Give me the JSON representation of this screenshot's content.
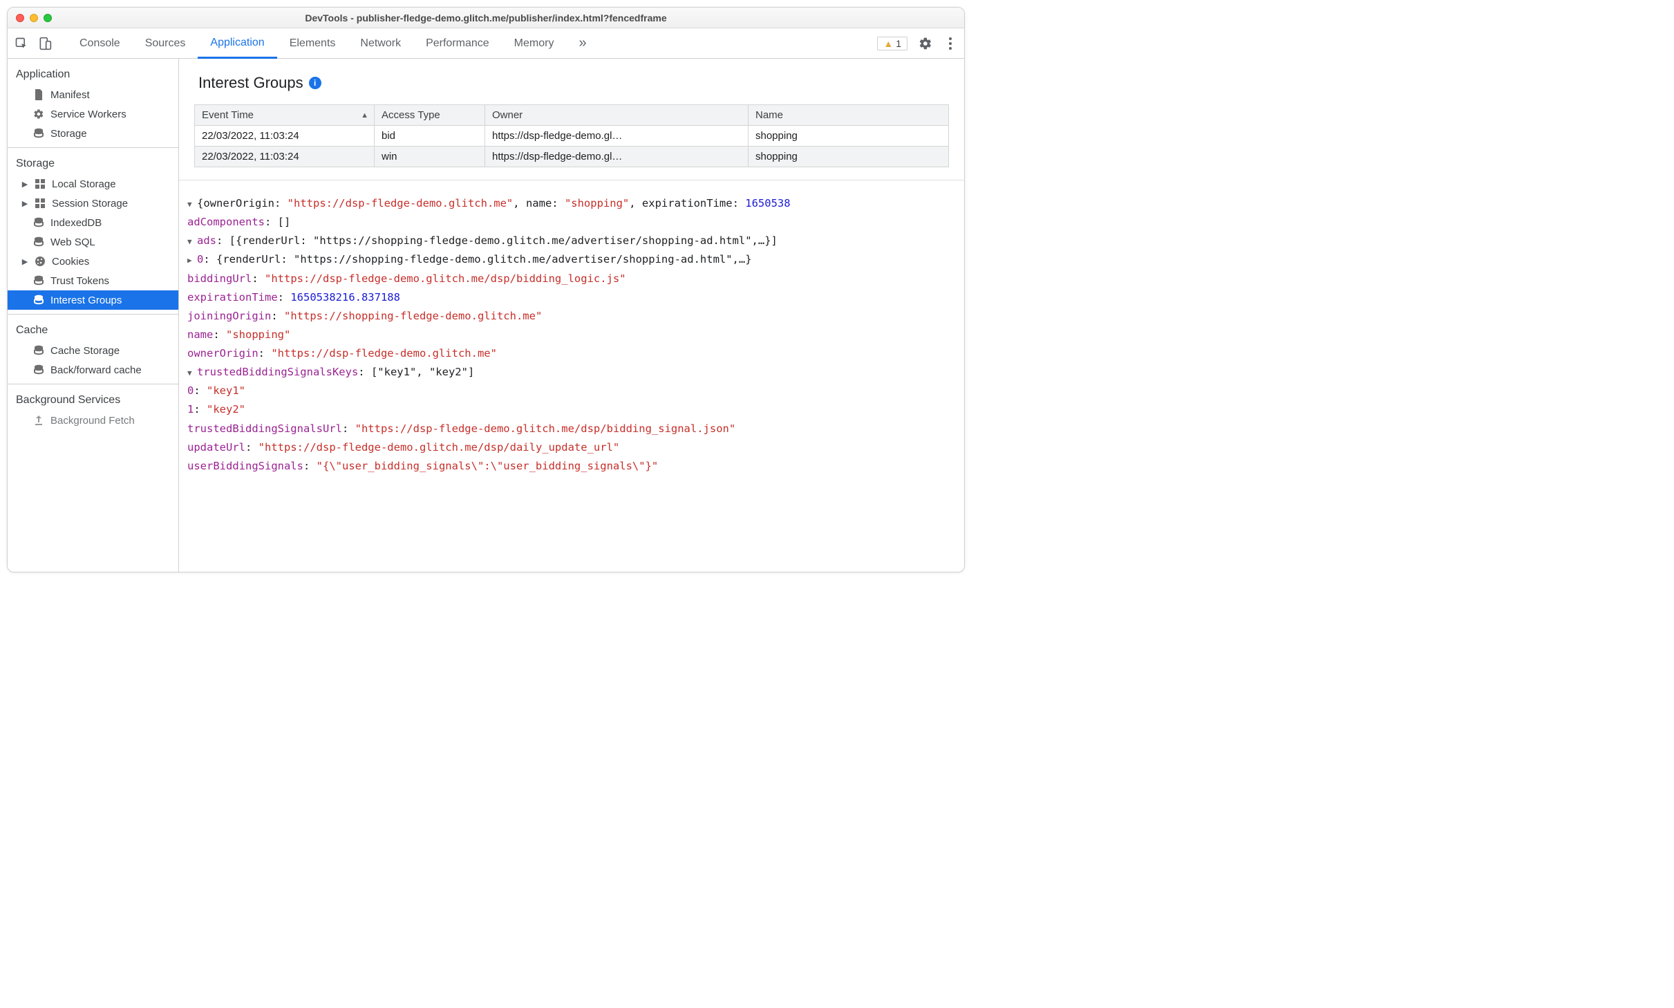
{
  "window": {
    "title": "DevTools - publisher-fledge-demo.glitch.me/publisher/index.html?fencedframe"
  },
  "tabs": {
    "items": [
      "Console",
      "Sources",
      "Application",
      "Elements",
      "Network",
      "Performance",
      "Memory"
    ],
    "overflow_glyph": "»",
    "warning_count": "1"
  },
  "sidebar": {
    "section_application": "Application",
    "manifest": "Manifest",
    "service_workers": "Service Workers",
    "storage": "Storage",
    "section_storage": "Storage",
    "local_storage": "Local Storage",
    "session_storage": "Session Storage",
    "indexeddb": "IndexedDB",
    "web_sql": "Web SQL",
    "cookies": "Cookies",
    "trust_tokens": "Trust Tokens",
    "interest_groups": "Interest Groups",
    "section_cache": "Cache",
    "cache_storage": "Cache Storage",
    "back_forward_cache": "Back/forward cache",
    "section_background": "Background Services",
    "background_fetch": "Background Fetch"
  },
  "panel": {
    "title": "Interest Groups",
    "table": {
      "headers": {
        "time": "Event Time",
        "type": "Access Type",
        "owner": "Owner",
        "name": "Name"
      },
      "rows": [
        {
          "time": "22/03/2022, 11:03:24",
          "type": "bid",
          "owner": "https://dsp-fledge-demo.gl…",
          "name": "shopping"
        },
        {
          "time": "22/03/2022, 11:03:24",
          "type": "win",
          "owner": "https://dsp-fledge-demo.gl…",
          "name": "shopping"
        }
      ]
    },
    "detail": {
      "root_prefix": "{ownerOrigin: ",
      "root_owner": "\"https://dsp-fledge-demo.glitch.me\"",
      "root_mid": ", name: ",
      "root_name": "\"shopping\"",
      "root_mid2": ", expirationTime: ",
      "root_exp": "1650538",
      "adComponents_key": "adComponents",
      "adComponents_val": "[]",
      "ads_key": "ads",
      "ads_summary": "[{renderUrl: \"https://shopping-fledge-demo.glitch.me/advertiser/shopping-ad.html\",…}]",
      "ads_0_key": "0",
      "ads_0_val": "{renderUrl: \"https://shopping-fledge-demo.glitch.me/advertiser/shopping-ad.html\",…}",
      "biddingUrl_key": "biddingUrl",
      "biddingUrl_val": "\"https://dsp-fledge-demo.glitch.me/dsp/bidding_logic.js\"",
      "expirationTime_key": "expirationTime",
      "expirationTime_val": "1650538216.837188",
      "joiningOrigin_key": "joiningOrigin",
      "joiningOrigin_val": "\"https://shopping-fledge-demo.glitch.me\"",
      "name_key": "name",
      "name_val": "\"shopping\"",
      "ownerOrigin_key": "ownerOrigin",
      "ownerOrigin_val": "\"https://dsp-fledge-demo.glitch.me\"",
      "tbsk_key": "trustedBiddingSignalsKeys",
      "tbsk_val": "[\"key1\", \"key2\"]",
      "tbsk_0_key": "0",
      "tbsk_0_val": "\"key1\"",
      "tbsk_1_key": "1",
      "tbsk_1_val": "\"key2\"",
      "tbsu_key": "trustedBiddingSignalsUrl",
      "tbsu_val": "\"https://dsp-fledge-demo.glitch.me/dsp/bidding_signal.json\"",
      "updateUrl_key": "updateUrl",
      "updateUrl_val": "\"https://dsp-fledge-demo.glitch.me/dsp/daily_update_url\"",
      "ubs_key": "userBiddingSignals",
      "ubs_val": "\"{\\\"user_bidding_signals\\\":\\\"user_bidding_signals\\\"}\""
    }
  }
}
